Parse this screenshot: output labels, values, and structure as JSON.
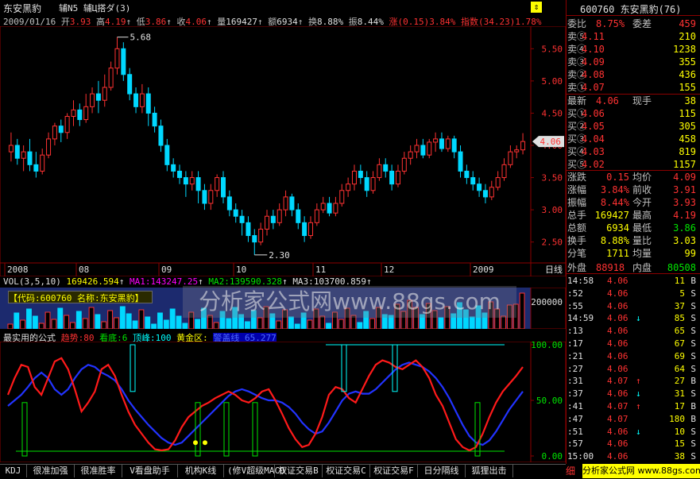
{
  "header": {
    "name": "东安黑豹",
    "tab1": "辅N5 辅Ц搭ダ(3)",
    "date": "2009/01/16",
    "open_lbl": "开",
    "open": "3.93",
    "high_lbl": "高",
    "high": "4.19",
    "low_lbl": "低",
    "low": "3.86",
    "close_lbl": "收",
    "close": "4.06",
    "vol_lbl": "量",
    "vol": "169427",
    "amt_lbl": "额",
    "amt": "6934",
    "turn_lbl": "换",
    "turn": "8.88%",
    "amp_lbl": "振",
    "amp": "8.44%",
    "chg_lbl": "涨",
    "chg": "(0.15)3.84%",
    "idx_lbl": "指数",
    "idx": "(34.23)1.78%"
  },
  "price_chart": {
    "y_ticks": [
      "5.50",
      "5.00",
      "4.50",
      "4.00",
      "3.50",
      "3.00",
      "2.50"
    ],
    "y_values": [
      5.5,
      5.0,
      4.5,
      4.0,
      3.5,
      3.0,
      2.5
    ],
    "max_label": "5.68",
    "min_label": "2.30",
    "cur_label": "4.06",
    "x_ticks": [
      "2008",
      "08",
      "09",
      "10",
      "11",
      "12",
      "2009"
    ],
    "period": "日线"
  },
  "candles": [
    [
      3.9,
      4.0,
      3.75,
      4.2
    ],
    [
      4.0,
      3.8,
      3.7,
      4.1
    ],
    [
      3.8,
      3.9,
      3.6,
      4.0
    ],
    [
      3.9,
      3.7,
      3.6,
      4.1
    ],
    [
      3.7,
      3.6,
      3.5,
      3.9
    ],
    [
      3.6,
      3.85,
      3.55,
      3.95
    ],
    [
      3.85,
      4.1,
      3.8,
      4.2
    ],
    [
      4.1,
      4.3,
      4.0,
      4.35
    ],
    [
      4.3,
      4.2,
      4.05,
      4.4
    ],
    [
      4.2,
      4.45,
      4.1,
      4.5
    ],
    [
      4.45,
      4.55,
      4.3,
      4.7
    ],
    [
      4.55,
      4.4,
      4.3,
      4.65
    ],
    [
      4.4,
      4.6,
      4.35,
      4.8
    ],
    [
      4.6,
      4.8,
      4.5,
      4.9
    ],
    [
      4.8,
      4.7,
      4.5,
      5.0
    ],
    [
      4.7,
      4.9,
      4.6,
      5.1
    ],
    [
      4.9,
      5.2,
      4.85,
      5.3
    ],
    [
      5.2,
      5.5,
      5.1,
      5.68
    ],
    [
      5.5,
      5.1,
      5.0,
      5.6
    ],
    [
      5.1,
      4.8,
      4.7,
      5.2
    ],
    [
      4.8,
      4.6,
      4.5,
      4.9
    ],
    [
      4.6,
      4.8,
      4.5,
      4.95
    ],
    [
      4.8,
      4.5,
      4.3,
      4.9
    ],
    [
      4.5,
      4.3,
      4.2,
      4.6
    ],
    [
      4.3,
      4.0,
      3.9,
      4.4
    ],
    [
      4.0,
      3.7,
      3.6,
      4.1
    ],
    [
      3.7,
      3.6,
      3.5,
      3.8
    ],
    [
      3.6,
      3.5,
      3.4,
      3.7
    ],
    [
      3.5,
      3.4,
      3.2,
      3.6
    ],
    [
      3.4,
      3.5,
      3.3,
      3.6
    ],
    [
      3.5,
      3.3,
      3.1,
      3.6
    ],
    [
      3.3,
      3.1,
      3.0,
      3.4
    ],
    [
      3.1,
      3.3,
      3.0,
      3.4
    ],
    [
      3.3,
      3.5,
      3.2,
      3.55
    ],
    [
      3.5,
      3.2,
      3.1,
      3.6
    ],
    [
      3.2,
      3.0,
      2.9,
      3.3
    ],
    [
      3.0,
      2.9,
      2.8,
      3.1
    ],
    [
      2.9,
      2.8,
      2.6,
      3.0
    ],
    [
      2.8,
      2.6,
      2.5,
      2.9
    ],
    [
      2.6,
      2.5,
      2.3,
      2.7
    ],
    [
      2.5,
      2.7,
      2.45,
      2.8
    ],
    [
      2.7,
      2.9,
      2.6,
      3.0
    ],
    [
      2.9,
      2.8,
      2.7,
      3.0
    ],
    [
      2.8,
      3.0,
      2.75,
      3.1
    ],
    [
      3.0,
      3.2,
      2.9,
      3.3
    ],
    [
      3.2,
      3.0,
      2.9,
      3.25
    ],
    [
      3.0,
      2.8,
      2.7,
      3.1
    ],
    [
      2.8,
      2.6,
      2.5,
      2.9
    ],
    [
      2.6,
      2.8,
      2.55,
      2.9
    ],
    [
      2.8,
      3.0,
      2.75,
      3.1
    ],
    [
      3.0,
      3.1,
      2.95,
      3.2
    ],
    [
      3.1,
      2.95,
      2.9,
      3.2
    ],
    [
      2.95,
      3.1,
      2.9,
      3.2
    ],
    [
      3.1,
      3.3,
      3.05,
      3.4
    ],
    [
      3.3,
      3.4,
      3.2,
      3.5
    ],
    [
      3.4,
      3.6,
      3.3,
      3.7
    ],
    [
      3.6,
      3.5,
      3.4,
      3.7
    ],
    [
      3.5,
      3.3,
      3.2,
      3.6
    ],
    [
      3.3,
      3.5,
      3.25,
      3.6
    ],
    [
      3.5,
      3.7,
      3.45,
      3.8
    ],
    [
      3.7,
      3.6,
      3.5,
      3.8
    ],
    [
      3.6,
      3.4,
      3.3,
      3.7
    ],
    [
      3.4,
      3.6,
      3.35,
      3.7
    ],
    [
      3.6,
      3.8,
      3.55,
      3.9
    ],
    [
      3.8,
      3.9,
      3.7,
      4.0
    ],
    [
      3.9,
      4.0,
      3.8,
      4.1
    ],
    [
      4.0,
      3.85,
      3.8,
      4.1
    ],
    [
      3.85,
      4.05,
      3.8,
      4.1
    ],
    [
      4.05,
      4.1,
      3.9,
      4.2
    ],
    [
      4.1,
      3.95,
      3.9,
      4.2
    ],
    [
      3.95,
      4.1,
      3.9,
      4.15
    ],
    [
      4.1,
      3.9,
      3.8,
      4.15
    ],
    [
      3.9,
      3.6,
      3.5,
      4.0
    ],
    [
      3.6,
      3.5,
      3.4,
      3.7
    ],
    [
      3.5,
      3.4,
      3.3,
      3.6
    ],
    [
      3.4,
      3.3,
      3.2,
      3.5
    ],
    [
      3.3,
      3.2,
      3.1,
      3.4
    ],
    [
      3.2,
      3.35,
      3.15,
      3.45
    ],
    [
      3.35,
      3.5,
      3.3,
      3.6
    ],
    [
      3.5,
      3.7,
      3.45,
      3.8
    ],
    [
      3.7,
      3.9,
      3.65,
      4.0
    ],
    [
      3.9,
      3.93,
      3.8,
      4.0
    ],
    [
      3.93,
      4.06,
      3.86,
      4.19
    ]
  ],
  "vol_chart": {
    "title": "VOL(3,5,10)",
    "val": "169426.594",
    "ma1_lbl": "MA1:",
    "ma1": "143247.25",
    "ma2_lbl": "MA2:",
    "ma2": "139590.328",
    "ma3_lbl": "MA3:",
    "ma3": "103700.859",
    "y_tick": "200000",
    "code_box": "【代码:600760  名称:东安黑豹】",
    "watermark": "分析家公式网www.88gs.com"
  },
  "formula": {
    "title": "最实用的公式",
    "l1": "趋势:",
    "v1": "80",
    "l2": "看底:",
    "v2": "6",
    "l3": "顶峰:",
    "v3": "100",
    "l4": "黄金区:",
    "l5": "警盖线",
    "v5": "65.277",
    "y_ticks": [
      "100.00",
      "50.00",
      "0.00"
    ],
    "y_values": [
      100,
      50,
      0
    ]
  },
  "quote": {
    "code": "600760",
    "name": "东安黑豹",
    "num": "(76)",
    "wb_lbl": "委比",
    "wb": "8.75%",
    "wc_lbl": "委差",
    "wc": "459",
    "sells": [
      {
        "lbl": "卖⑤",
        "p": "4.11",
        "v": "210"
      },
      {
        "lbl": "卖④",
        "p": "4.10",
        "v": "1238"
      },
      {
        "lbl": "卖③",
        "p": "4.09",
        "v": "355"
      },
      {
        "lbl": "卖②",
        "p": "4.08",
        "v": "436"
      },
      {
        "lbl": "卖①",
        "p": "4.07",
        "v": "155"
      }
    ],
    "last_lbl": "最新",
    "last": "4.06",
    "cur_lbl": "现手",
    "cur": "38",
    "buys": [
      {
        "lbl": "买①",
        "p": "4.06",
        "v": "115"
      },
      {
        "lbl": "买②",
        "p": "4.05",
        "v": "305"
      },
      {
        "lbl": "买③",
        "p": "4.04",
        "v": "458"
      },
      {
        "lbl": "买④",
        "p": "4.03",
        "v": "819"
      },
      {
        "lbl": "买⑤",
        "p": "4.02",
        "v": "1157"
      }
    ],
    "stats": [
      {
        "l1": "涨跌",
        "v1": "0.15",
        "l2": "均价",
        "v2": "4.09"
      },
      {
        "l1": "涨幅",
        "v1": "3.84%",
        "l2": "前收",
        "v2": "3.91"
      },
      {
        "l1": "振幅",
        "v1": "8.44%",
        "l2": "今开",
        "v2": "3.93"
      },
      {
        "l1": "总手",
        "v1": "169427",
        "l2": "最高",
        "v2": "4.19"
      },
      {
        "l1": "总额",
        "v1": "6934",
        "l2": "最低",
        "v2": "3.86"
      },
      {
        "l1": "换手",
        "v1": "8.88%",
        "l2": "量比",
        "v2": "3.03"
      },
      {
        "l1": "分笔",
        "v1": "1711",
        "l2": "均量",
        "v2": "99"
      }
    ],
    "out_lbl": "外盘",
    "out": "88918",
    "in_lbl": "内盘",
    "in": "80508"
  },
  "ticks": [
    {
      "t": "14:58",
      "p": "4.06",
      "a": "",
      "v": "11",
      "s": "B"
    },
    {
      "t": ":52",
      "p": "4.06",
      "a": "",
      "v": "5",
      "s": "S"
    },
    {
      "t": ":55",
      "p": "4.06",
      "a": "",
      "v": "37",
      "s": "S"
    },
    {
      "t": "14:59",
      "p": "4.06",
      "a": "↓",
      "v": "85",
      "s": "S"
    },
    {
      "t": ":13",
      "p": "4.06",
      "a": "",
      "v": "65",
      "s": "S"
    },
    {
      "t": ":17",
      "p": "4.06",
      "a": "",
      "v": "67",
      "s": "S"
    },
    {
      "t": ":21",
      "p": "4.06",
      "a": "",
      "v": "69",
      "s": "S"
    },
    {
      "t": ":27",
      "p": "4.06",
      "a": "",
      "v": "64",
      "s": "S"
    },
    {
      "t": ":31",
      "p": "4.07",
      "a": "↑",
      "v": "27",
      "s": "B"
    },
    {
      "t": ":37",
      "p": "4.06",
      "a": "↓",
      "v": "31",
      "s": "S"
    },
    {
      "t": ":41",
      "p": "4.07",
      "a": "↑",
      "v": "17",
      "s": "B"
    },
    {
      "t": ":47",
      "p": "4.07",
      "a": "",
      "v": "180",
      "s": "B"
    },
    {
      "t": ":51",
      "p": "4.06",
      "a": "↓",
      "v": "10",
      "s": "S"
    },
    {
      "t": ":57",
      "p": "4.06",
      "a": "",
      "v": "15",
      "s": "S"
    },
    {
      "t": "15:00",
      "p": "4.06",
      "a": "",
      "v": "38",
      "s": "S"
    }
  ],
  "bottom_tabs": [
    "KDJ",
    "很准加强",
    "很准胜率",
    "V看盘助手",
    "机构K线",
    "(修V超级MACD",
    "权证交易B",
    "权证交易C",
    "权证交易F",
    "日分隔线",
    "狐狸出击"
  ],
  "site_badge": "分析家公式网 www.88gs.com",
  "fin_lbl": "细"
}
